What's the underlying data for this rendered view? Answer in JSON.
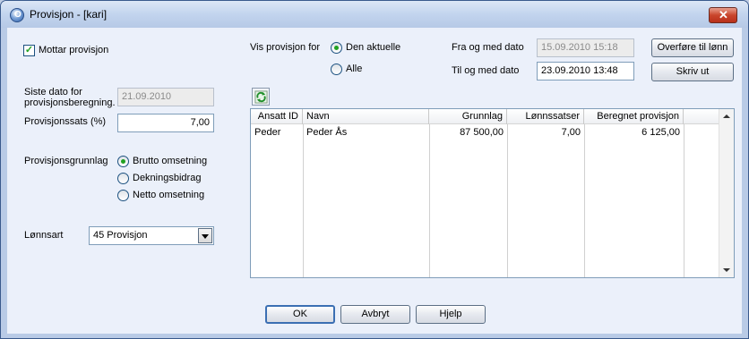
{
  "window": {
    "title": "Provisjon - [kari]",
    "app_icon": "app-logo-icon",
    "close_icon": "close-icon"
  },
  "left": {
    "mottar_label": "Mottar provisjon",
    "mottar_checked": true,
    "siste_dato_label_1": "Siste dato for",
    "siste_dato_label_2": "provisjonsberegning.",
    "siste_dato_value": "21.09.2010",
    "sats_label": "Provisjonssats (%)",
    "sats_value": "7,00",
    "grunnlag_label": "Provisjonsgrunnlag",
    "grunnlag_options": [
      "Brutto omsetning",
      "Dekningsbidrag",
      "Netto omsetning"
    ],
    "grunnlag_selected": "Brutto omsetning",
    "lonnsart_label": "Lønnsart",
    "lonnsart_value": "45  Provisjon"
  },
  "filter": {
    "vis_label": "Vis provisjon for",
    "options": [
      "Den aktuelle",
      "Alle"
    ],
    "selected": "Den aktuelle",
    "fra_label": "Fra og med dato",
    "fra_value": "15.09.2010 15:18",
    "til_label": "Til og med dato",
    "til_value": "23.09.2010 13:48"
  },
  "actions": {
    "overfore": "Overføre til lønn",
    "skriv_ut": "Skriv ut",
    "refresh_icon": "refresh-icon"
  },
  "table": {
    "columns": [
      "Ansatt ID",
      "Navn",
      "Grunnlag",
      "Lønnssatser",
      "Beregnet provisjon"
    ],
    "rows": [
      [
        "Peder",
        "Peder Ås",
        "87 500,00",
        "7,00",
        "6 125,00"
      ]
    ]
  },
  "footer": {
    "ok": "OK",
    "avbryt": "Avbryt",
    "hjelp": "Hjelp"
  }
}
